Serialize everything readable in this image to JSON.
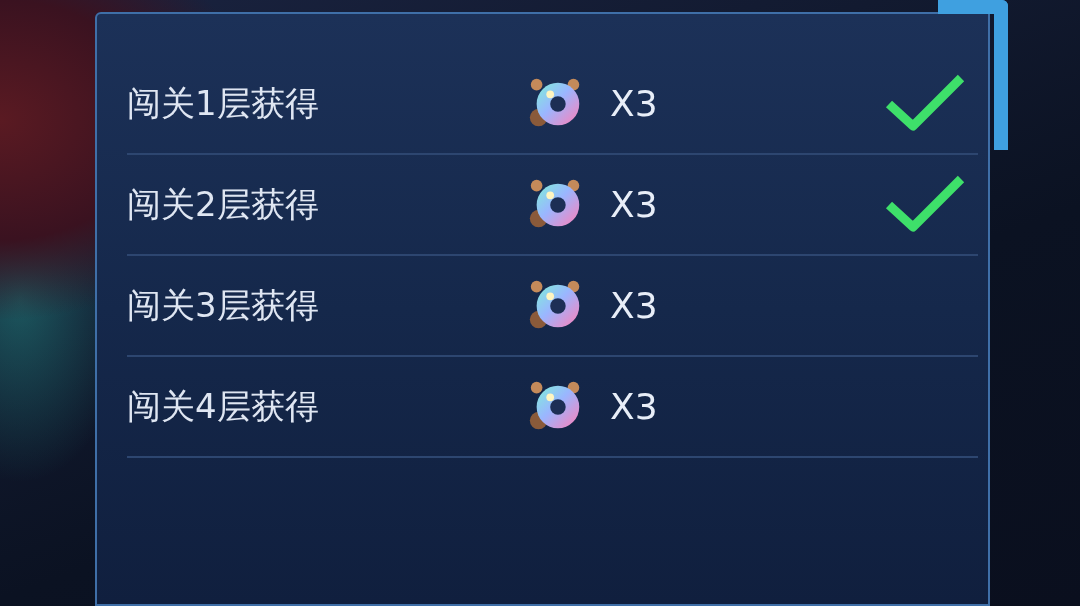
{
  "rows": [
    {
      "label": "闯关1层获得",
      "amount": "X3",
      "completed": true
    },
    {
      "label": "闯关2层获得",
      "amount": "X3",
      "completed": true
    },
    {
      "label": "闯关3层获得",
      "amount": "X3",
      "completed": false
    },
    {
      "label": "闯关4层获得",
      "amount": "X3",
      "completed": false
    }
  ]
}
